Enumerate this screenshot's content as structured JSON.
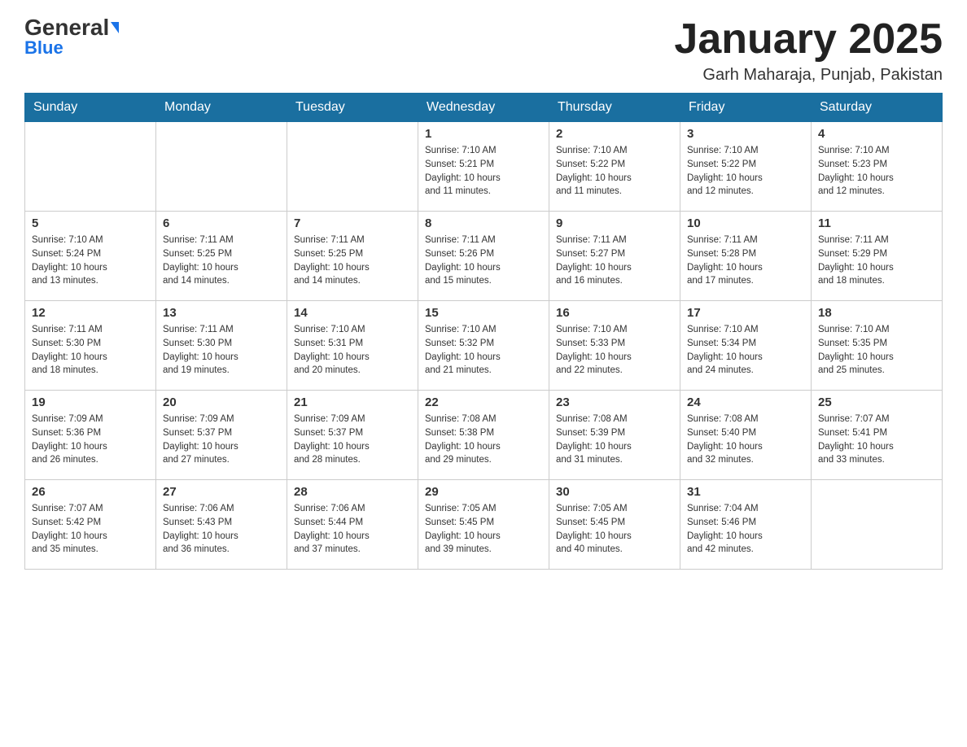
{
  "header": {
    "logo_main": "General",
    "logo_sub": "Blue",
    "month_title": "January 2025",
    "location": "Garh Maharaja, Punjab, Pakistan"
  },
  "days_of_week": [
    "Sunday",
    "Monday",
    "Tuesday",
    "Wednesday",
    "Thursday",
    "Friday",
    "Saturday"
  ],
  "weeks": [
    [
      {
        "day": "",
        "info": ""
      },
      {
        "day": "",
        "info": ""
      },
      {
        "day": "",
        "info": ""
      },
      {
        "day": "1",
        "info": "Sunrise: 7:10 AM\nSunset: 5:21 PM\nDaylight: 10 hours\nand 11 minutes."
      },
      {
        "day": "2",
        "info": "Sunrise: 7:10 AM\nSunset: 5:22 PM\nDaylight: 10 hours\nand 11 minutes."
      },
      {
        "day": "3",
        "info": "Sunrise: 7:10 AM\nSunset: 5:22 PM\nDaylight: 10 hours\nand 12 minutes."
      },
      {
        "day": "4",
        "info": "Sunrise: 7:10 AM\nSunset: 5:23 PM\nDaylight: 10 hours\nand 12 minutes."
      }
    ],
    [
      {
        "day": "5",
        "info": "Sunrise: 7:10 AM\nSunset: 5:24 PM\nDaylight: 10 hours\nand 13 minutes."
      },
      {
        "day": "6",
        "info": "Sunrise: 7:11 AM\nSunset: 5:25 PM\nDaylight: 10 hours\nand 14 minutes."
      },
      {
        "day": "7",
        "info": "Sunrise: 7:11 AM\nSunset: 5:25 PM\nDaylight: 10 hours\nand 14 minutes."
      },
      {
        "day": "8",
        "info": "Sunrise: 7:11 AM\nSunset: 5:26 PM\nDaylight: 10 hours\nand 15 minutes."
      },
      {
        "day": "9",
        "info": "Sunrise: 7:11 AM\nSunset: 5:27 PM\nDaylight: 10 hours\nand 16 minutes."
      },
      {
        "day": "10",
        "info": "Sunrise: 7:11 AM\nSunset: 5:28 PM\nDaylight: 10 hours\nand 17 minutes."
      },
      {
        "day": "11",
        "info": "Sunrise: 7:11 AM\nSunset: 5:29 PM\nDaylight: 10 hours\nand 18 minutes."
      }
    ],
    [
      {
        "day": "12",
        "info": "Sunrise: 7:11 AM\nSunset: 5:30 PM\nDaylight: 10 hours\nand 18 minutes."
      },
      {
        "day": "13",
        "info": "Sunrise: 7:11 AM\nSunset: 5:30 PM\nDaylight: 10 hours\nand 19 minutes."
      },
      {
        "day": "14",
        "info": "Sunrise: 7:10 AM\nSunset: 5:31 PM\nDaylight: 10 hours\nand 20 minutes."
      },
      {
        "day": "15",
        "info": "Sunrise: 7:10 AM\nSunset: 5:32 PM\nDaylight: 10 hours\nand 21 minutes."
      },
      {
        "day": "16",
        "info": "Sunrise: 7:10 AM\nSunset: 5:33 PM\nDaylight: 10 hours\nand 22 minutes."
      },
      {
        "day": "17",
        "info": "Sunrise: 7:10 AM\nSunset: 5:34 PM\nDaylight: 10 hours\nand 24 minutes."
      },
      {
        "day": "18",
        "info": "Sunrise: 7:10 AM\nSunset: 5:35 PM\nDaylight: 10 hours\nand 25 minutes."
      }
    ],
    [
      {
        "day": "19",
        "info": "Sunrise: 7:09 AM\nSunset: 5:36 PM\nDaylight: 10 hours\nand 26 minutes."
      },
      {
        "day": "20",
        "info": "Sunrise: 7:09 AM\nSunset: 5:37 PM\nDaylight: 10 hours\nand 27 minutes."
      },
      {
        "day": "21",
        "info": "Sunrise: 7:09 AM\nSunset: 5:37 PM\nDaylight: 10 hours\nand 28 minutes."
      },
      {
        "day": "22",
        "info": "Sunrise: 7:08 AM\nSunset: 5:38 PM\nDaylight: 10 hours\nand 29 minutes."
      },
      {
        "day": "23",
        "info": "Sunrise: 7:08 AM\nSunset: 5:39 PM\nDaylight: 10 hours\nand 31 minutes."
      },
      {
        "day": "24",
        "info": "Sunrise: 7:08 AM\nSunset: 5:40 PM\nDaylight: 10 hours\nand 32 minutes."
      },
      {
        "day": "25",
        "info": "Sunrise: 7:07 AM\nSunset: 5:41 PM\nDaylight: 10 hours\nand 33 minutes."
      }
    ],
    [
      {
        "day": "26",
        "info": "Sunrise: 7:07 AM\nSunset: 5:42 PM\nDaylight: 10 hours\nand 35 minutes."
      },
      {
        "day": "27",
        "info": "Sunrise: 7:06 AM\nSunset: 5:43 PM\nDaylight: 10 hours\nand 36 minutes."
      },
      {
        "day": "28",
        "info": "Sunrise: 7:06 AM\nSunset: 5:44 PM\nDaylight: 10 hours\nand 37 minutes."
      },
      {
        "day": "29",
        "info": "Sunrise: 7:05 AM\nSunset: 5:45 PM\nDaylight: 10 hours\nand 39 minutes."
      },
      {
        "day": "30",
        "info": "Sunrise: 7:05 AM\nSunset: 5:45 PM\nDaylight: 10 hours\nand 40 minutes."
      },
      {
        "day": "31",
        "info": "Sunrise: 7:04 AM\nSunset: 5:46 PM\nDaylight: 10 hours\nand 42 minutes."
      },
      {
        "day": "",
        "info": ""
      }
    ]
  ]
}
